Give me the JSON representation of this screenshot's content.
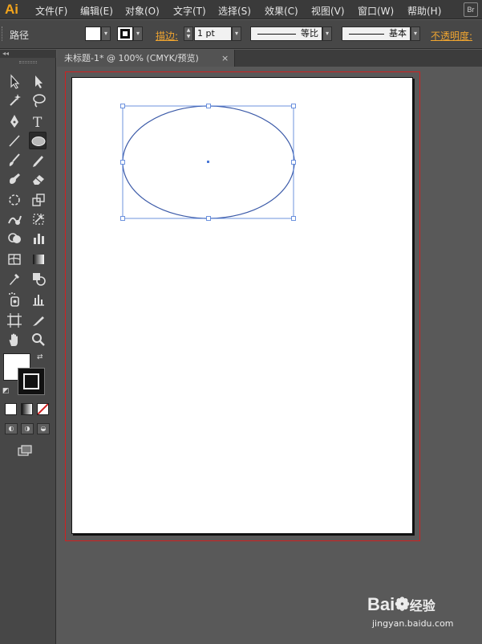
{
  "app": {
    "logo": "Ai",
    "bridge_label": "Br"
  },
  "menu": [
    "文件(F)",
    "编辑(E)",
    "对象(O)",
    "文字(T)",
    "选择(S)",
    "效果(C)",
    "视图(V)",
    "窗口(W)",
    "帮助(H)"
  ],
  "control_bar": {
    "selection_type": "路径",
    "stroke_label": "描边:",
    "stroke_weight": "1 pt",
    "profile_label": "等比",
    "brush_label": "基本",
    "opacity_label": "不透明度:"
  },
  "tools_panel": {
    "collapse_glyph": "◂◂"
  },
  "document": {
    "tab_title": "未标题-1* @ 100% (CMYK/预览)",
    "close_glyph": "×"
  },
  "watermark": {
    "brand": "Bai",
    "brand_cn": "经验",
    "url": "jingyan.baidu.com"
  },
  "colors": {
    "accent": "#f0a530",
    "selection": "#4a78d6",
    "bleed_guide": "#d02020"
  }
}
